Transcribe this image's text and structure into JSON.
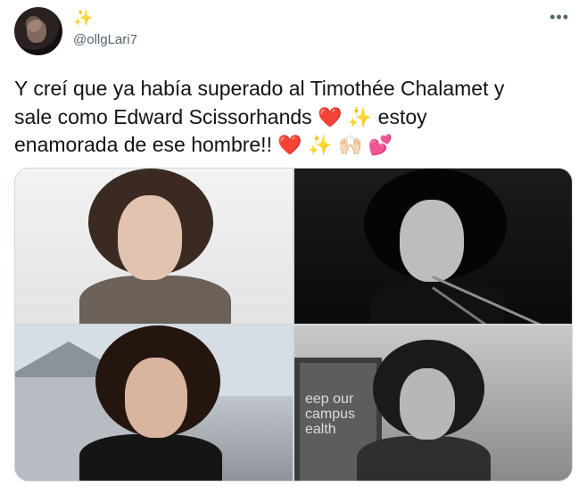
{
  "user": {
    "display_name": "✨",
    "handle": "@ollgLari7",
    "avatar": "profile-photo"
  },
  "tweet": {
    "text_lines": [
      "Y creí que ya había superado al Timothée Chalamet y",
      "sale como Edward Scissorhands",
      "estoy",
      "enamorada de ese hombre!!"
    ],
    "emoji_line2": [
      "❤️",
      "✨"
    ],
    "emoji_line3": [
      "❤️",
      "✨",
      "🙌🏻",
      "💕"
    ]
  },
  "menu": {
    "more_label": "•••"
  },
  "media": {
    "photos": [
      {
        "name": "photo-1",
        "style": "color-portrait"
      },
      {
        "name": "photo-2",
        "style": "black-and-white-scissorhands"
      },
      {
        "name": "photo-3",
        "style": "costume-outdoor"
      },
      {
        "name": "photo-4",
        "style": "black-and-white-sign"
      }
    ]
  },
  "colors": {
    "text": "#0f1419",
    "secondary": "#536471",
    "border": "#cfd9de",
    "heart": "#dd2e44",
    "sparkle": "#fbbf24"
  }
}
